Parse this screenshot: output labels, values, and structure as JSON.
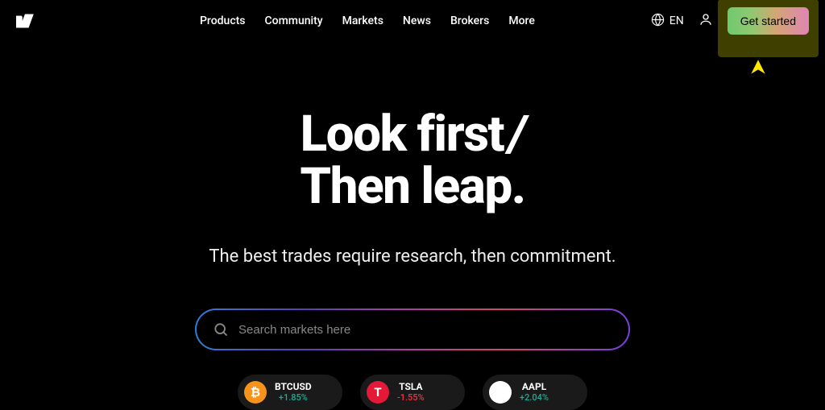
{
  "nav": {
    "items": [
      "Products",
      "Community",
      "Markets",
      "News",
      "Brokers",
      "More"
    ]
  },
  "header": {
    "lang_label": "EN",
    "cta_label": "Get started"
  },
  "hero": {
    "headline_line1": "Look first",
    "headline_slash": "/",
    "headline_line2": "Then leap.",
    "subhead": "The best trades require research, then commitment."
  },
  "search": {
    "placeholder": "Search markets here"
  },
  "tickers": [
    {
      "symbol": "BTCUSD",
      "change": "+1.85%",
      "direction": "up"
    },
    {
      "symbol": "TSLA",
      "change": "-1.55%",
      "direction": "down"
    },
    {
      "symbol": "AAPL",
      "change": "+2.04%",
      "direction": "up"
    }
  ]
}
